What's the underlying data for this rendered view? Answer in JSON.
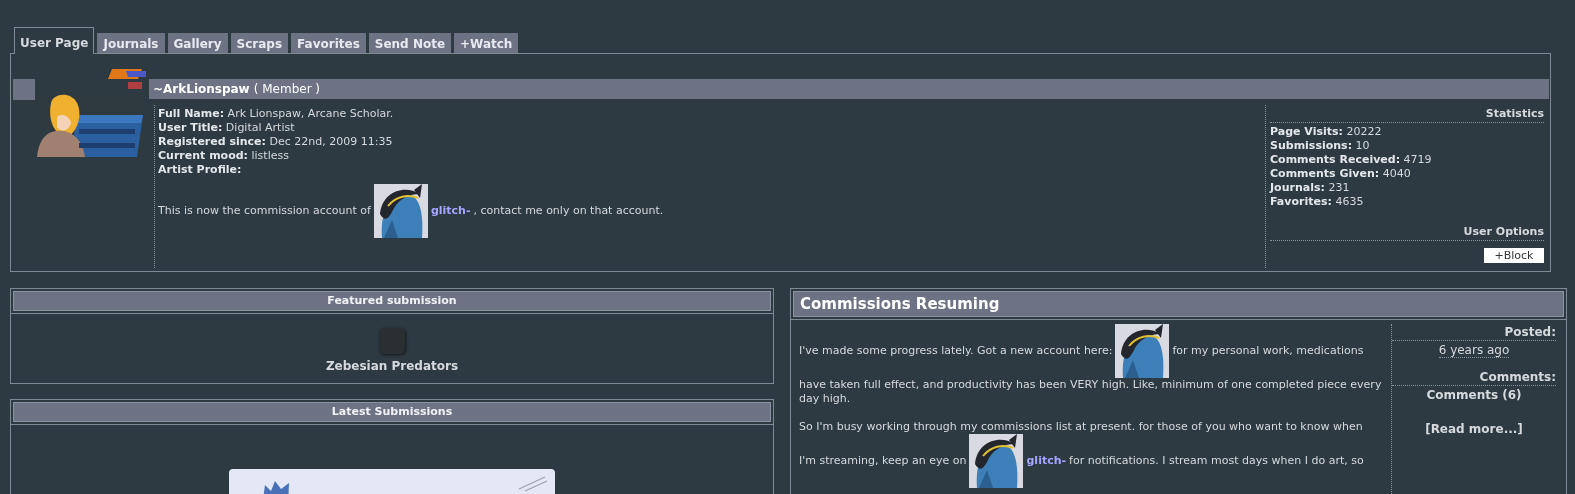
{
  "tabs": [
    {
      "label": "User Page",
      "selected": true
    },
    {
      "label": "Journals",
      "selected": false
    },
    {
      "label": "Gallery",
      "selected": false
    },
    {
      "label": "Scraps",
      "selected": false
    },
    {
      "label": "Favorites",
      "selected": false
    },
    {
      "label": "Send Note",
      "selected": false
    },
    {
      "label": "+Watch",
      "selected": false
    }
  ],
  "profile": {
    "username": "~ArkLionspaw",
    "role": "( Member )",
    "fields": [
      {
        "label": "Full Name:",
        "value": "Ark Lionspaw, Arcane Scholar."
      },
      {
        "label": "User Title:",
        "value": "Digital Artist"
      },
      {
        "label": "Registered since:",
        "value": "Dec 22nd, 2009 11:35"
      },
      {
        "label": "Current mood:",
        "value": "listless"
      },
      {
        "label": "Artist Profile:"
      }
    ],
    "note": {
      "before": "This is now the commission account of",
      "link": "glitch-",
      "after": ", contact me only on that account."
    }
  },
  "statistics": {
    "title": "Statistics",
    "items": [
      {
        "label": "Page Visits:",
        "value": "20222"
      },
      {
        "label": "Submissions:",
        "value": "10"
      },
      {
        "label": "Comments Received:",
        "value": "4719"
      },
      {
        "label": "Comments Given:",
        "value": "4040"
      },
      {
        "label": "Journals:",
        "value": "231"
      },
      {
        "label": "Favorites:",
        "value": "4635"
      }
    ]
  },
  "user_options": {
    "title": "User Options",
    "button": "+Block"
  },
  "featured": {
    "title": "Featured submission",
    "caption": "Zebesian Predators"
  },
  "latest": {
    "title": "Latest Submissions"
  },
  "journal": {
    "title": "Commissions Resuming",
    "lines": [
      [
        {
          "kind": "text",
          "text": "I've made some progress lately. Got a new account here:"
        },
        {
          "kind": "picture"
        },
        {
          "kind": "text",
          "text": "for my personal work, medications"
        }
      ],
      [
        {
          "kind": "text",
          "text": "have taken full effect, and productivity has been VERY high. Like, minimum of one completed piece every day high."
        }
      ],
      [
        {
          "kind": "gap"
        }
      ],
      [
        {
          "kind": "text",
          "text": "So I'm busy working through my commissions list at present. for those of you who want to know when"
        }
      ],
      [
        {
          "kind": "text",
          "text": "I'm streaming, keep an eye on"
        },
        {
          "kind": "picture"
        },
        {
          "kind": "link",
          "text": "glitch-"
        },
        {
          "kind": "text",
          "text": "for notifications. I stream most days when I do art, so"
        }
      ]
    ],
    "posted_label": "Posted:",
    "posted": "6 years ago",
    "comments_label": "Comments:",
    "comments": "Comments (6)",
    "read_more": "[Read more...]"
  }
}
